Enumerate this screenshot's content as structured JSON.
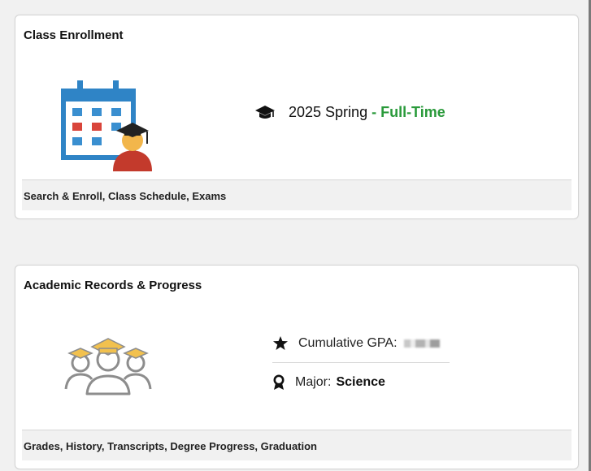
{
  "enrollment": {
    "title": "Class Enrollment",
    "term": "2025 Spring",
    "status": "- Full-Time",
    "footer": "Search & Enroll, Class Schedule, Exams",
    "icons": [
      "calendar-student-icon",
      "graduation-cap-icon"
    ]
  },
  "records": {
    "title": "Academic Records & Progress",
    "gpa_label": "Cumulative GPA:",
    "major_label": "Major:",
    "major_value": "Science",
    "footer": "Grades, History, Transcripts, Degree Progress, Graduation",
    "icons": [
      "students-group-icon",
      "star-icon",
      "award-ribbon-icon"
    ]
  },
  "colors": {
    "status_green": "#2a9a3b",
    "calendar_blue": "#2f84c6",
    "highlight_red": "#d9453b",
    "cap_gold": "#f2c14e"
  }
}
